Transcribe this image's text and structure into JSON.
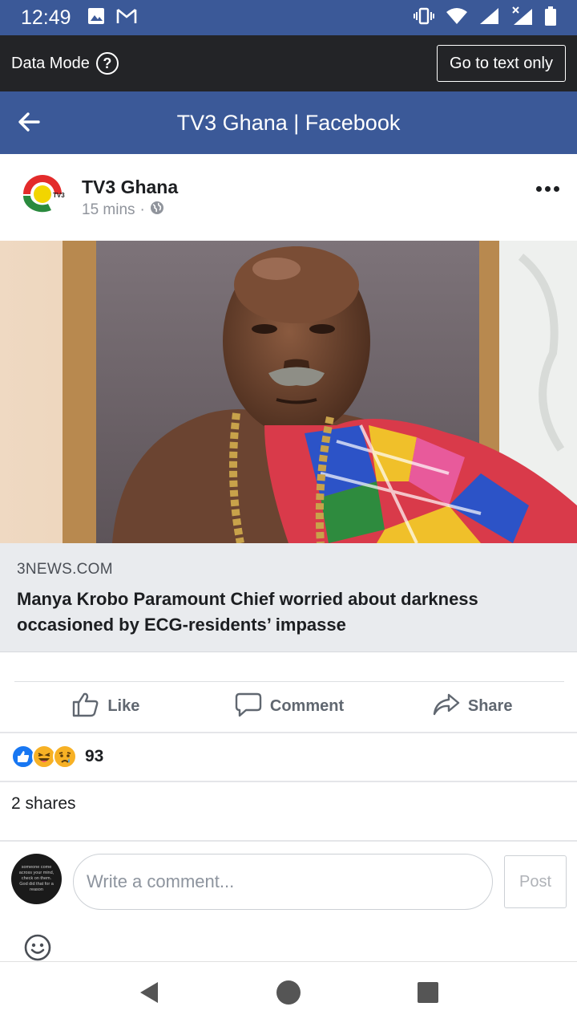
{
  "status_bar": {
    "time": "12:49",
    "icons_left": [
      "image-icon",
      "gmail-icon"
    ],
    "icons_right": [
      "vibrate-icon",
      "wifi-icon",
      "signal-icon",
      "signal-x-icon",
      "battery-icon"
    ]
  },
  "data_bar": {
    "label": "Data Mode",
    "help_symbol": "?",
    "text_only_label": "Go to text only"
  },
  "title_bar": {
    "title": "TV3 Ghana | Facebook"
  },
  "post": {
    "page_name": "TV3 Ghana",
    "logo_text": "TV3",
    "time": "15 mins",
    "separator": "·",
    "link": {
      "domain": "3NEWS.COM",
      "headline": "Manya Krobo Paramount Chief worried about darkness occasioned by ECG-residents’ impasse"
    },
    "actions": {
      "like": "Like",
      "comment": "Comment",
      "share": "Share"
    },
    "reactions": {
      "types": [
        "like",
        "haha",
        "sad"
      ],
      "count": "93"
    },
    "shares": "2 shares"
  },
  "comment_box": {
    "avatar_text": "someone come across your mind, check on them. God did that for a reason",
    "placeholder": "Write a comment...",
    "post_label": "Post"
  },
  "colors": {
    "brand_blue": "#3b5998",
    "dark_bar": "#232427",
    "link_card_bg": "#e9ebee",
    "like_blue": "#1877f2",
    "emoji_yellow": "#f7b125"
  }
}
